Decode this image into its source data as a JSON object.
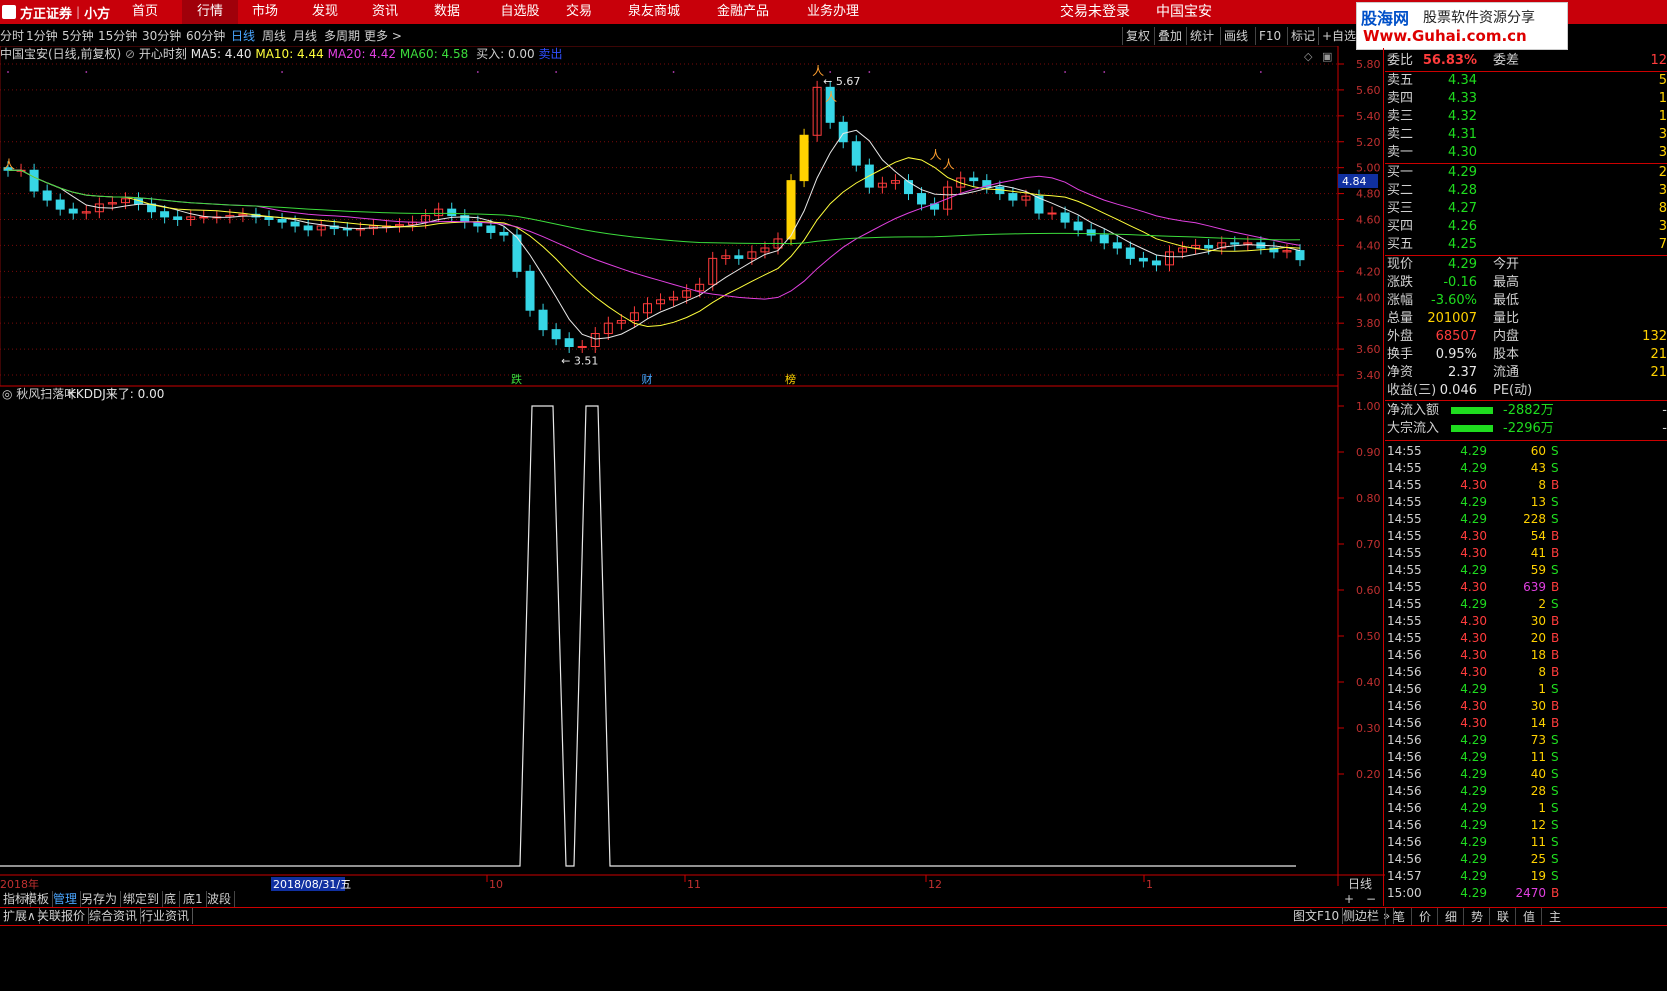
{
  "brand": {
    "name": "方正证券",
    "product": "小方"
  },
  "nav": [
    "首页",
    "行情",
    "市场",
    "发现",
    "资讯",
    "数据",
    "自选股",
    "交易",
    "泉友商城",
    "金融产品",
    "业务办理"
  ],
  "nav_active": 1,
  "login_text": "交易未登录",
  "stock_name_header": "中国宝安",
  "watermark": {
    "line1": "股海网",
    "line1b": "股票软件资源分享",
    "line2": "Www.Guhai.com.cn"
  },
  "periods": [
    "分时",
    "1分钟",
    "5分钟",
    "15分钟",
    "30分钟",
    "60分钟",
    "日线",
    "周线",
    "月线",
    "多周期",
    "更多 >"
  ],
  "period_active": 6,
  "tools": [
    "复权",
    "叠加",
    "统计",
    "画线",
    "F10",
    "标记",
    "+自选"
  ],
  "info": {
    "title": "中国宝安(日线,前复权)",
    "indicator": "开心时刻",
    "ma5": "MA5: 4.40",
    "ma10": "MA10: 4.44",
    "ma20": "MA20: 4.42",
    "ma60": "MA60: 4.58",
    "buy": "买入: 0.00",
    "sell": "卖出"
  },
  "price_axis": [
    "5.80",
    "5.60",
    "5.40",
    "5.20",
    "5.00",
    "4.80",
    "4.60",
    "4.40",
    "4.20",
    "4.00",
    "3.80",
    "3.60",
    "3.40"
  ],
  "current_price_tag": "4.84",
  "annot_high": "5.67",
  "annot_low": "3.51",
  "event_labels": [
    "跌",
    "财",
    "榜"
  ],
  "sub": {
    "title": "秋风扫落叶",
    "value": "KKDDJ来了: 0.00",
    "axis": [
      "1.00",
      "0.90",
      "0.80",
      "0.70",
      "0.60",
      "0.50",
      "0.40",
      "0.30",
      "0.20"
    ]
  },
  "date_axis": {
    "start": "2018年",
    "cursor": "2018/08/31/五",
    "months": [
      "10",
      "11",
      "12",
      "1"
    ],
    "right": "日线"
  },
  "zoom": [
    "+",
    "−"
  ],
  "bottom_tabs": [
    "指标",
    "模板",
    "管理",
    "另存为",
    "绑定到",
    "底",
    "底1",
    "波段"
  ],
  "bottom_tab_active": 2,
  "bottom_tabs2": [
    "扩展∧",
    "关联报价",
    "综合资讯",
    "行业资讯"
  ],
  "bottom_right": [
    "图文F10",
    "侧边栏 »"
  ],
  "right_tabs": [
    "笔",
    "价",
    "细",
    "势",
    "联",
    "值",
    "主"
  ],
  "quote": {
    "weibi_label": "委比",
    "weibi": "56.83%",
    "weicha_label": "委差",
    "weicha": "12",
    "asks": [
      {
        "label": "卖五",
        "price": "4.34",
        "vol": "5"
      },
      {
        "label": "卖四",
        "price": "4.33",
        "vol": "1"
      },
      {
        "label": "卖三",
        "price": "4.32",
        "vol": "1"
      },
      {
        "label": "卖二",
        "price": "4.31",
        "vol": "3"
      },
      {
        "label": "卖一",
        "price": "4.30",
        "vol": "3"
      }
    ],
    "bids": [
      {
        "label": "买一",
        "price": "4.29",
        "vol": "2"
      },
      {
        "label": "买二",
        "price": "4.28",
        "vol": "3"
      },
      {
        "label": "买三",
        "price": "4.27",
        "vol": "8"
      },
      {
        "label": "买四",
        "price": "4.26",
        "vol": "3"
      },
      {
        "label": "买五",
        "price": "4.25",
        "vol": "7"
      }
    ],
    "stats": [
      {
        "l1": "现价",
        "v1": "4.29",
        "c1": "green",
        "l2": "今开",
        "v2": ""
      },
      {
        "l1": "涨跌",
        "v1": "-0.16",
        "c1": "green",
        "l2": "最高",
        "v2": ""
      },
      {
        "l1": "涨幅",
        "v1": "-3.60%",
        "c1": "green",
        "l2": "最低",
        "v2": ""
      },
      {
        "l1": "总量",
        "v1": "201007",
        "c1": "yellow",
        "l2": "量比",
        "v2": ""
      },
      {
        "l1": "外盘",
        "v1": "68507",
        "c1": "red",
        "l2": "内盘",
        "v2": "132"
      },
      {
        "l1": "换手",
        "v1": "0.95%",
        "c1": "white",
        "l2": "股本",
        "v2": "21"
      },
      {
        "l1": "净资",
        "v1": "2.37",
        "c1": "white",
        "l2": "流通",
        "v2": "21"
      },
      {
        "l1": "收益(三)",
        "v1": "0.046",
        "c1": "white",
        "l2": "PE(动)",
        "v2": ""
      }
    ],
    "flows": [
      {
        "label": "净流入额",
        "value": "-2882万",
        "trail": "-"
      },
      {
        "label": "大宗流入",
        "value": "-2296万",
        "trail": "-"
      }
    ]
  },
  "ticks": [
    {
      "t": "14:55",
      "p": "4.29",
      "v": "60",
      "s": "S"
    },
    {
      "t": "14:55",
      "p": "4.29",
      "v": "43",
      "s": "S"
    },
    {
      "t": "14:55",
      "p": "4.30",
      "v": "8",
      "s": "B"
    },
    {
      "t": "14:55",
      "p": "4.29",
      "v": "13",
      "s": "S"
    },
    {
      "t": "14:55",
      "p": "4.29",
      "v": "228",
      "s": "S"
    },
    {
      "t": "14:55",
      "p": "4.30",
      "v": "54",
      "s": "B"
    },
    {
      "t": "14:55",
      "p": "4.30",
      "v": "41",
      "s": "B"
    },
    {
      "t": "14:55",
      "p": "4.29",
      "v": "59",
      "s": "S"
    },
    {
      "t": "14:55",
      "p": "4.30",
      "v": "639",
      "s": "B"
    },
    {
      "t": "14:55",
      "p": "4.29",
      "v": "2",
      "s": "S"
    },
    {
      "t": "14:55",
      "p": "4.30",
      "v": "30",
      "s": "B"
    },
    {
      "t": "14:55",
      "p": "4.30",
      "v": "20",
      "s": "B"
    },
    {
      "t": "14:56",
      "p": "4.30",
      "v": "18",
      "s": "B"
    },
    {
      "t": "14:56",
      "p": "4.30",
      "v": "8",
      "s": "B"
    },
    {
      "t": "14:56",
      "p": "4.29",
      "v": "1",
      "s": "S"
    },
    {
      "t": "14:56",
      "p": "4.30",
      "v": "30",
      "s": "B"
    },
    {
      "t": "14:56",
      "p": "4.30",
      "v": "14",
      "s": "B"
    },
    {
      "t": "14:56",
      "p": "4.29",
      "v": "73",
      "s": "S"
    },
    {
      "t": "14:56",
      "p": "4.29",
      "v": "11",
      "s": "S"
    },
    {
      "t": "14:56",
      "p": "4.29",
      "v": "40",
      "s": "S"
    },
    {
      "t": "14:56",
      "p": "4.29",
      "v": "28",
      "s": "S"
    },
    {
      "t": "14:56",
      "p": "4.29",
      "v": "1",
      "s": "S"
    },
    {
      "t": "14:56",
      "p": "4.29",
      "v": "12",
      "s": "S"
    },
    {
      "t": "14:56",
      "p": "4.29",
      "v": "11",
      "s": "S"
    },
    {
      "t": "14:56",
      "p": "4.29",
      "v": "25",
      "s": "S"
    },
    {
      "t": "14:57",
      "p": "4.29",
      "v": "19",
      "s": "S"
    },
    {
      "t": "15:00",
      "p": "4.29",
      "v": "2470",
      "s": "B"
    }
  ],
  "colors": {
    "up": "#ff3c3c",
    "down": "#37d6e6",
    "ma5": "#e8e8e8",
    "ma10": "#ffff3c",
    "ma20": "#e040e0",
    "ma60": "#3cdc3c",
    "limit_up": "#ffd200",
    "grid": "#7a0a0a"
  }
}
